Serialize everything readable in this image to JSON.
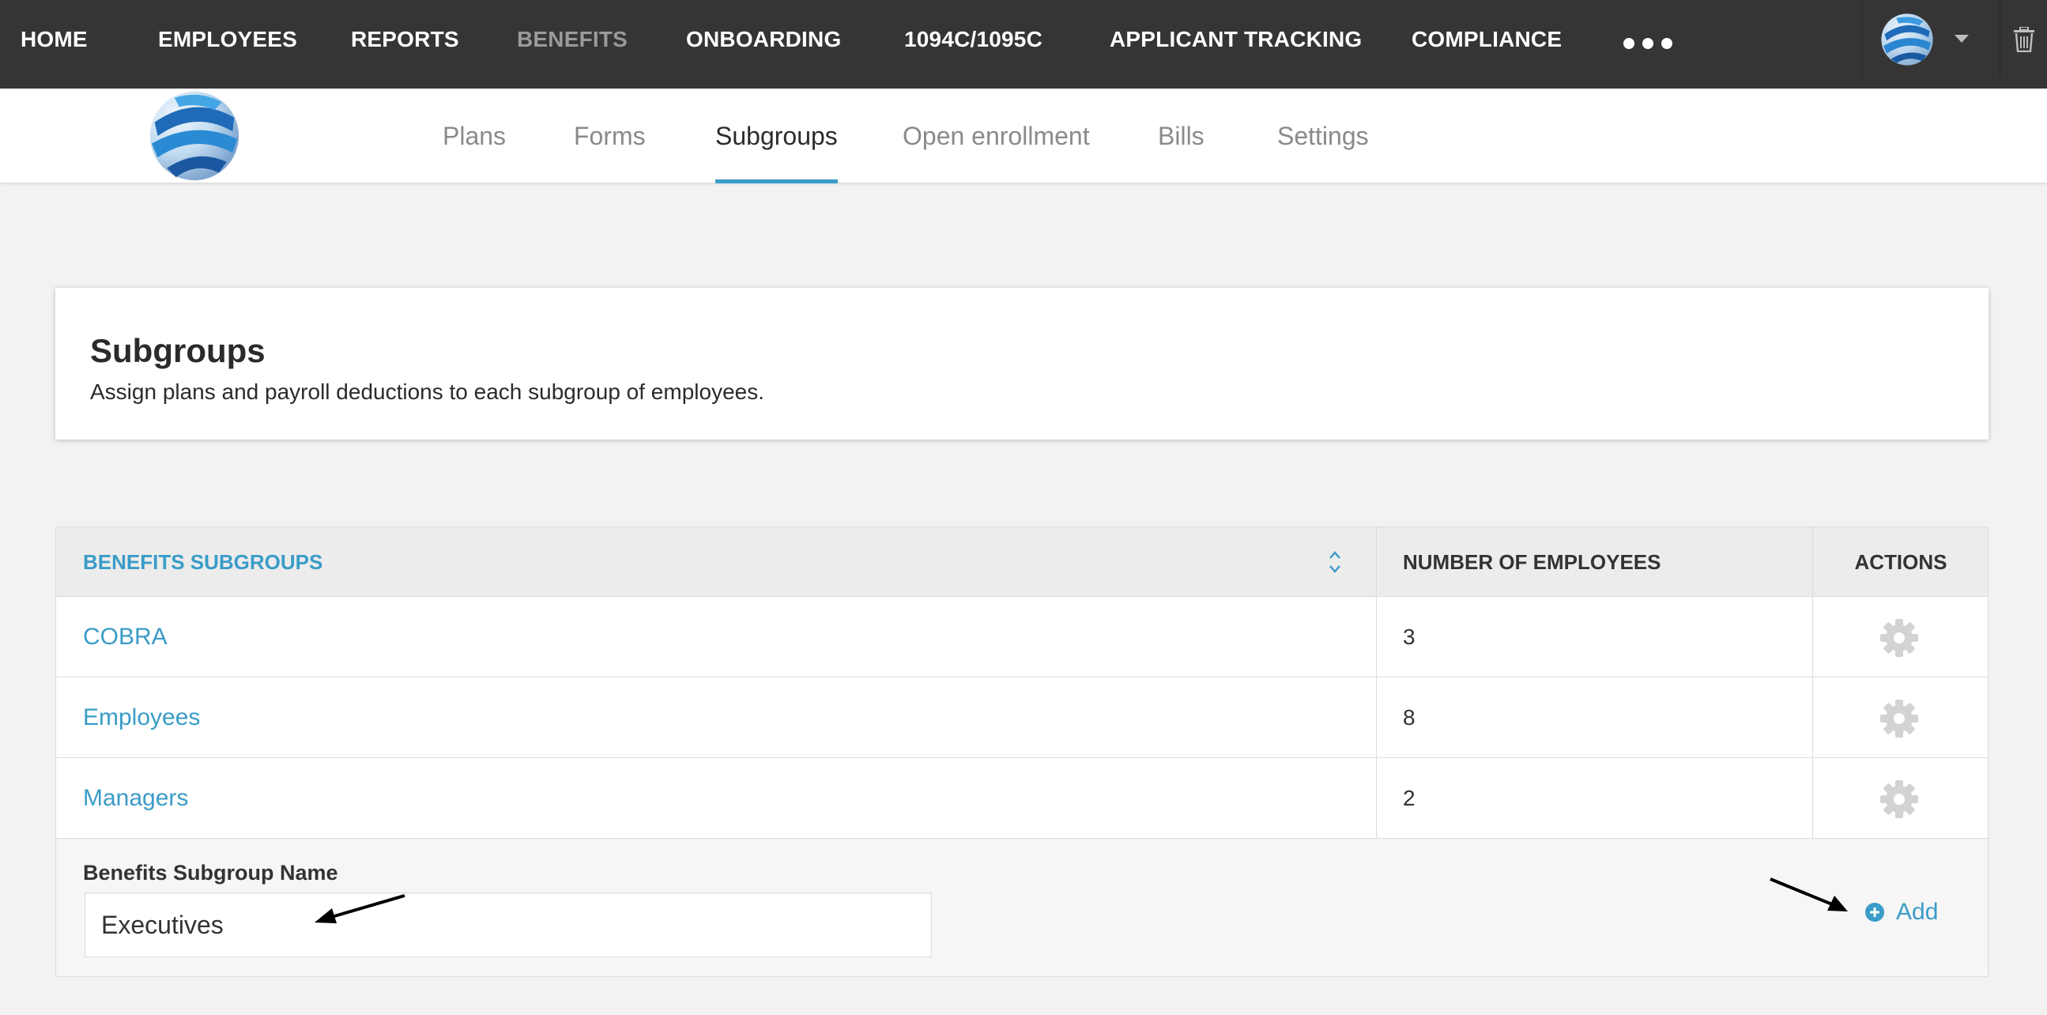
{
  "topnav": {
    "items": [
      {
        "label": "HOME"
      },
      {
        "label": "EMPLOYEES"
      },
      {
        "label": "REPORTS"
      },
      {
        "label": "BENEFITS",
        "active": true
      },
      {
        "label": "ONBOARDING"
      },
      {
        "label": "1094C/1095C"
      },
      {
        "label": "APPLICANT TRACKING"
      },
      {
        "label": "COMPLIANCE"
      }
    ],
    "more_icon": "ellipsis-icon",
    "user_icon": "globe-logo-icon",
    "caret_icon": "caret-down-icon",
    "trash_icon": "trash-icon"
  },
  "subnav": {
    "tabs": [
      {
        "label": "Plans"
      },
      {
        "label": "Forms"
      },
      {
        "label": "Subgroups",
        "active": true
      },
      {
        "label": "Open enrollment"
      },
      {
        "label": "Bills"
      },
      {
        "label": "Settings"
      }
    ]
  },
  "intro": {
    "title": "Subgroups",
    "description": "Assign plans and payroll deductions to each subgroup of employees."
  },
  "table": {
    "headers": {
      "subgroups": "BENEFITS SUBGROUPS",
      "count": "NUMBER OF EMPLOYEES",
      "actions": "ACTIONS"
    },
    "rows": [
      {
        "name": "COBRA",
        "count": "3"
      },
      {
        "name": "Employees",
        "count": "8"
      },
      {
        "name": "Managers",
        "count": "2"
      }
    ],
    "new_row": {
      "label": "Benefits Subgroup Name",
      "value": "Executives",
      "add_label": "Add"
    }
  },
  "colors": {
    "nav_bg": "#353535",
    "accent": "#3a9cc8",
    "page_bg": "#f2f2f2",
    "gear": "#d0d0d0"
  }
}
